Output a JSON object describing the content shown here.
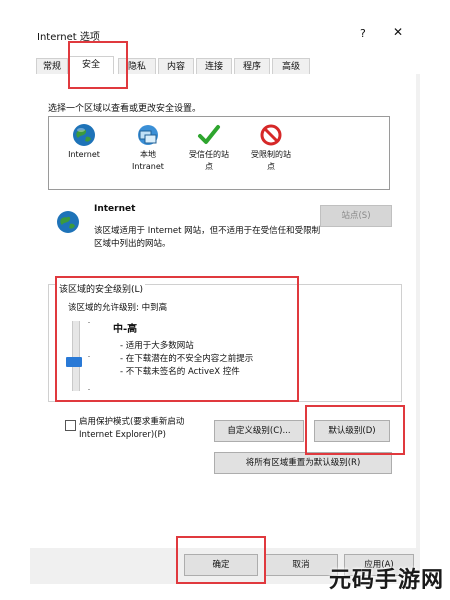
{
  "window": {
    "title": "Internet 选项",
    "help": "?",
    "close": "✕"
  },
  "tabs": [
    "常规",
    "安全",
    "隐私",
    "内容",
    "连接",
    "程序",
    "高级"
  ],
  "active_tab": "安全",
  "security": {
    "zone_prompt": "选择一个区域以查看或更改安全设置。",
    "zones": [
      {
        "label": "Internet",
        "icon": "globe-icon"
      },
      {
        "label": "本地\nIntranet",
        "icon": "intranet-icon"
      },
      {
        "label": "受信任的站\n点",
        "icon": "check-icon"
      },
      {
        "label": "受限制的站\n点",
        "icon": "restricted-icon"
      }
    ],
    "selected_zone_title": "Internet",
    "selected_zone_desc": "该区域适用于 Internet 网站，但不适用于在受信任和受限制区域中列出的网站。",
    "sites_button": "站点(S)",
    "level_group_label": "该区域的安全级别(L)",
    "allowed_levels_label": "该区域的允许级别: 中到高",
    "level_name": "中-高",
    "level_bullets": [
      "- 适用于大多数网站",
      "- 在下载潜在的不安全内容之前提示",
      "- 不下载未签名的 ActiveX 控件"
    ],
    "protected_mode_label": "启用保护模式(要求重新启动 Internet Explorer)(P)",
    "protected_mode_checked": false,
    "custom_level_button": "自定义级别(C)...",
    "default_level_button": "默认级别(D)",
    "reset_all_button": "将所有区域重置为默认级别(R)"
  },
  "footer": {
    "ok": "确定",
    "cancel": "取消",
    "apply": "应用(A)"
  },
  "watermark": "元码手游网",
  "colors": {
    "highlight": "#e0393e",
    "slider": "#2979d6"
  }
}
